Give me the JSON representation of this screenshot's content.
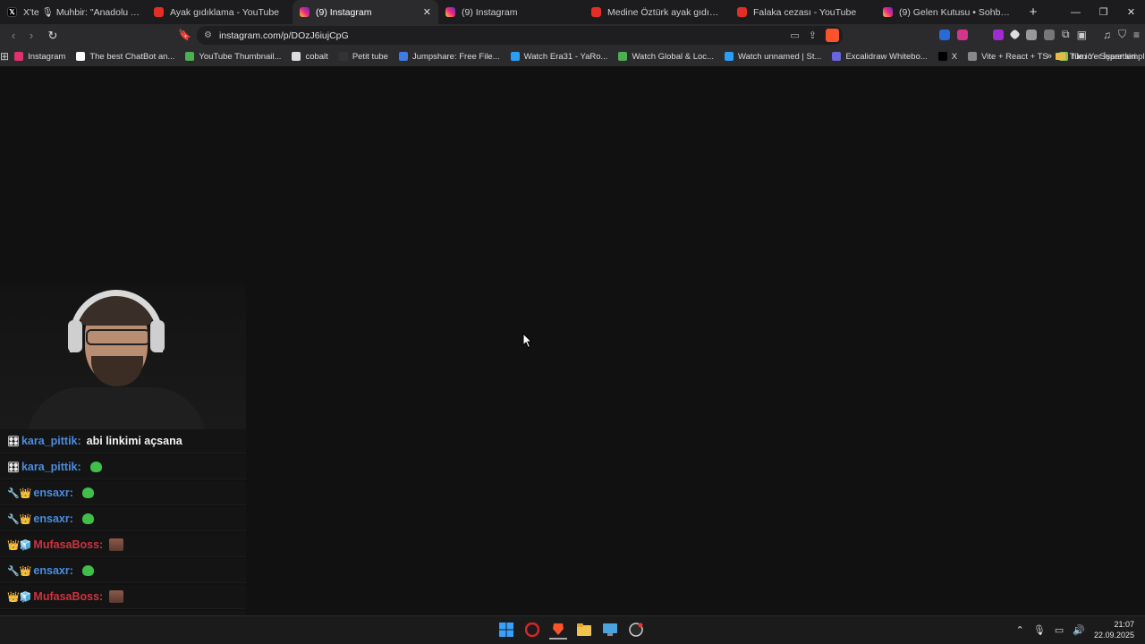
{
  "tabs": [
    {
      "label": "X'te 🎙 Muhbir: \"Anadolu Ajansı mu",
      "icon": "x-icon"
    },
    {
      "label": "Ayak gıdıklama - YouTube",
      "icon": "youtube-icon"
    },
    {
      "label": "(9) Instagram",
      "icon": "instagram-icon",
      "active": true
    },
    {
      "label": "(9) Instagram",
      "icon": "instagram-icon"
    },
    {
      "label": "Medine Öztürk ayak gıdıklama - You",
      "icon": "youtube-icon"
    },
    {
      "label": "Falaka cezası - YouTube",
      "icon": "youtube-icon"
    },
    {
      "label": "(9) Gelen Kutusu • Sohbetler",
      "icon": "instagram-icon"
    }
  ],
  "address": {
    "url": "instagram.com/p/DOzJ6iujCpG"
  },
  "bookmarks": [
    {
      "label": "Instagram",
      "color": "#e1306c"
    },
    {
      "label": "The best ChatBot an...",
      "color": "#ffffff"
    },
    {
      "label": "YouTube Thumbnail...",
      "color": "#4caf50"
    },
    {
      "label": "cobalt",
      "color": "#dddddd"
    },
    {
      "label": "Petit tube",
      "color": "#333333"
    },
    {
      "label": "Jumpshare: Free File...",
      "color": "#3f7be0"
    },
    {
      "label": "Watch Era31 - YaRo...",
      "color": "#2a9df4"
    },
    {
      "label": "Watch Global & Loc...",
      "color": "#4caf50"
    },
    {
      "label": "Watch unnamed | St...",
      "color": "#2a9df4"
    },
    {
      "label": "Excalidraw Whitebo...",
      "color": "#6965db"
    },
    {
      "label": "X",
      "color": "#000000"
    },
    {
      "label": "Vite + React + TS",
      "color": "#888888"
    },
    {
      "label": "file.io - Super simpl...",
      "color": "#8bc34a"
    }
  ],
  "bookmarks_folder": "Tüm Yer İşaretleri",
  "chat": [
    {
      "badges": "🎛",
      "user": "kara_pittik:",
      "color": "blue",
      "message": "abi linkimi açsana",
      "emote": ""
    },
    {
      "badges": "🎛",
      "user": "kara_pittik:",
      "color": "blue",
      "message": "",
      "emote": "green"
    },
    {
      "badges": "🔧👑",
      "user": "ensaxr:",
      "color": "blue",
      "message": "",
      "emote": "green"
    },
    {
      "badges": "🔧👑",
      "user": "ensaxr:",
      "color": "blue",
      "message": "",
      "emote": "green"
    },
    {
      "badges": "👑🧊",
      "user": "MufasaBoss:",
      "color": "red",
      "message": "",
      "emote": "img"
    },
    {
      "badges": "🔧👑",
      "user": "ensaxr:",
      "color": "blue",
      "message": "",
      "emote": "green"
    },
    {
      "badges": "👑🧊",
      "user": "MufasaBoss:",
      "color": "red",
      "message": "",
      "emote": "img"
    },
    {
      "badges": "👑🧊",
      "user": "MufasaBoss:",
      "color": "red",
      "message": "",
      "emote": "img"
    }
  ],
  "clock": {
    "time": "21:07",
    "date": "22.09.2025"
  }
}
